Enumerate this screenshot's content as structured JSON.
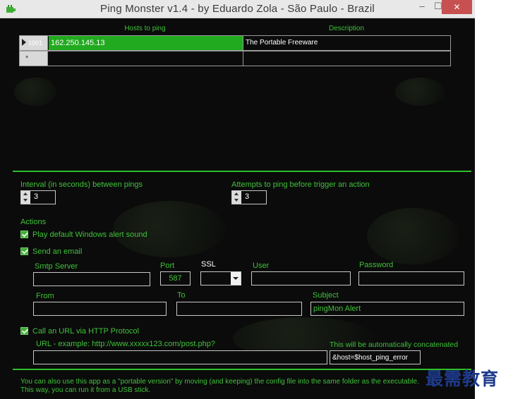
{
  "window": {
    "title": "Ping Monster v1.4  -  by Eduardo Zola  - São Paulo - Brazil",
    "minimize_glyph": "‒",
    "maximize_glyph": "☐",
    "close_glyph": "✕",
    "app_icon": "battery-plug-icon"
  },
  "grid": {
    "col_hosts": "Hosts to ping",
    "col_description": "Description",
    "rows": [
      {
        "id": "1001",
        "host": "162.250.145.13",
        "description": "The Portable Freeware",
        "selected": true
      }
    ],
    "new_row_marker": "*"
  },
  "interval": {
    "label": "Interval (in seconds) between pings",
    "value": "3"
  },
  "attempts": {
    "label": "Attempts to ping before trigger an action",
    "value": "3"
  },
  "actions": {
    "heading": "Actions",
    "play_sound": {
      "label": "Play default Windows alert sound",
      "checked": true
    },
    "send_email": {
      "label": "Send an email",
      "checked": true
    },
    "call_url": {
      "label": "Call an URL via HTTP Protocol",
      "checked": true
    }
  },
  "email": {
    "smtp_label": "Smtp Server",
    "smtp_value": "",
    "port_label": "Port",
    "port_value": "587",
    "ssl_label": "SSL",
    "ssl_value": "",
    "user_label": "User",
    "user_value": "",
    "password_label": "Password",
    "password_value": "",
    "from_label": "From",
    "from_value": "",
    "to_label": "To",
    "to_value": "",
    "subject_label": "Subject",
    "subject_value": "pingMon Alert"
  },
  "url": {
    "label": "URL  -  example:  http://www.xxxxx123.com/post.php?",
    "value": "",
    "concat_label": "This will be automatically concatenated",
    "concat_value": "&host=$host_ping_error"
  },
  "footer": {
    "line1": "You can also use this app as a \"portable version\" by moving (and keeping) the config file into the same folder as the executable.",
    "line2": "This way, you can run it from a USB stick."
  },
  "watermark": "最需教育",
  "colors": {
    "accent_green": "#3fc23a",
    "selection_green": "#21a91f",
    "background": "#0b0b0b",
    "close_red": "#c75050"
  }
}
